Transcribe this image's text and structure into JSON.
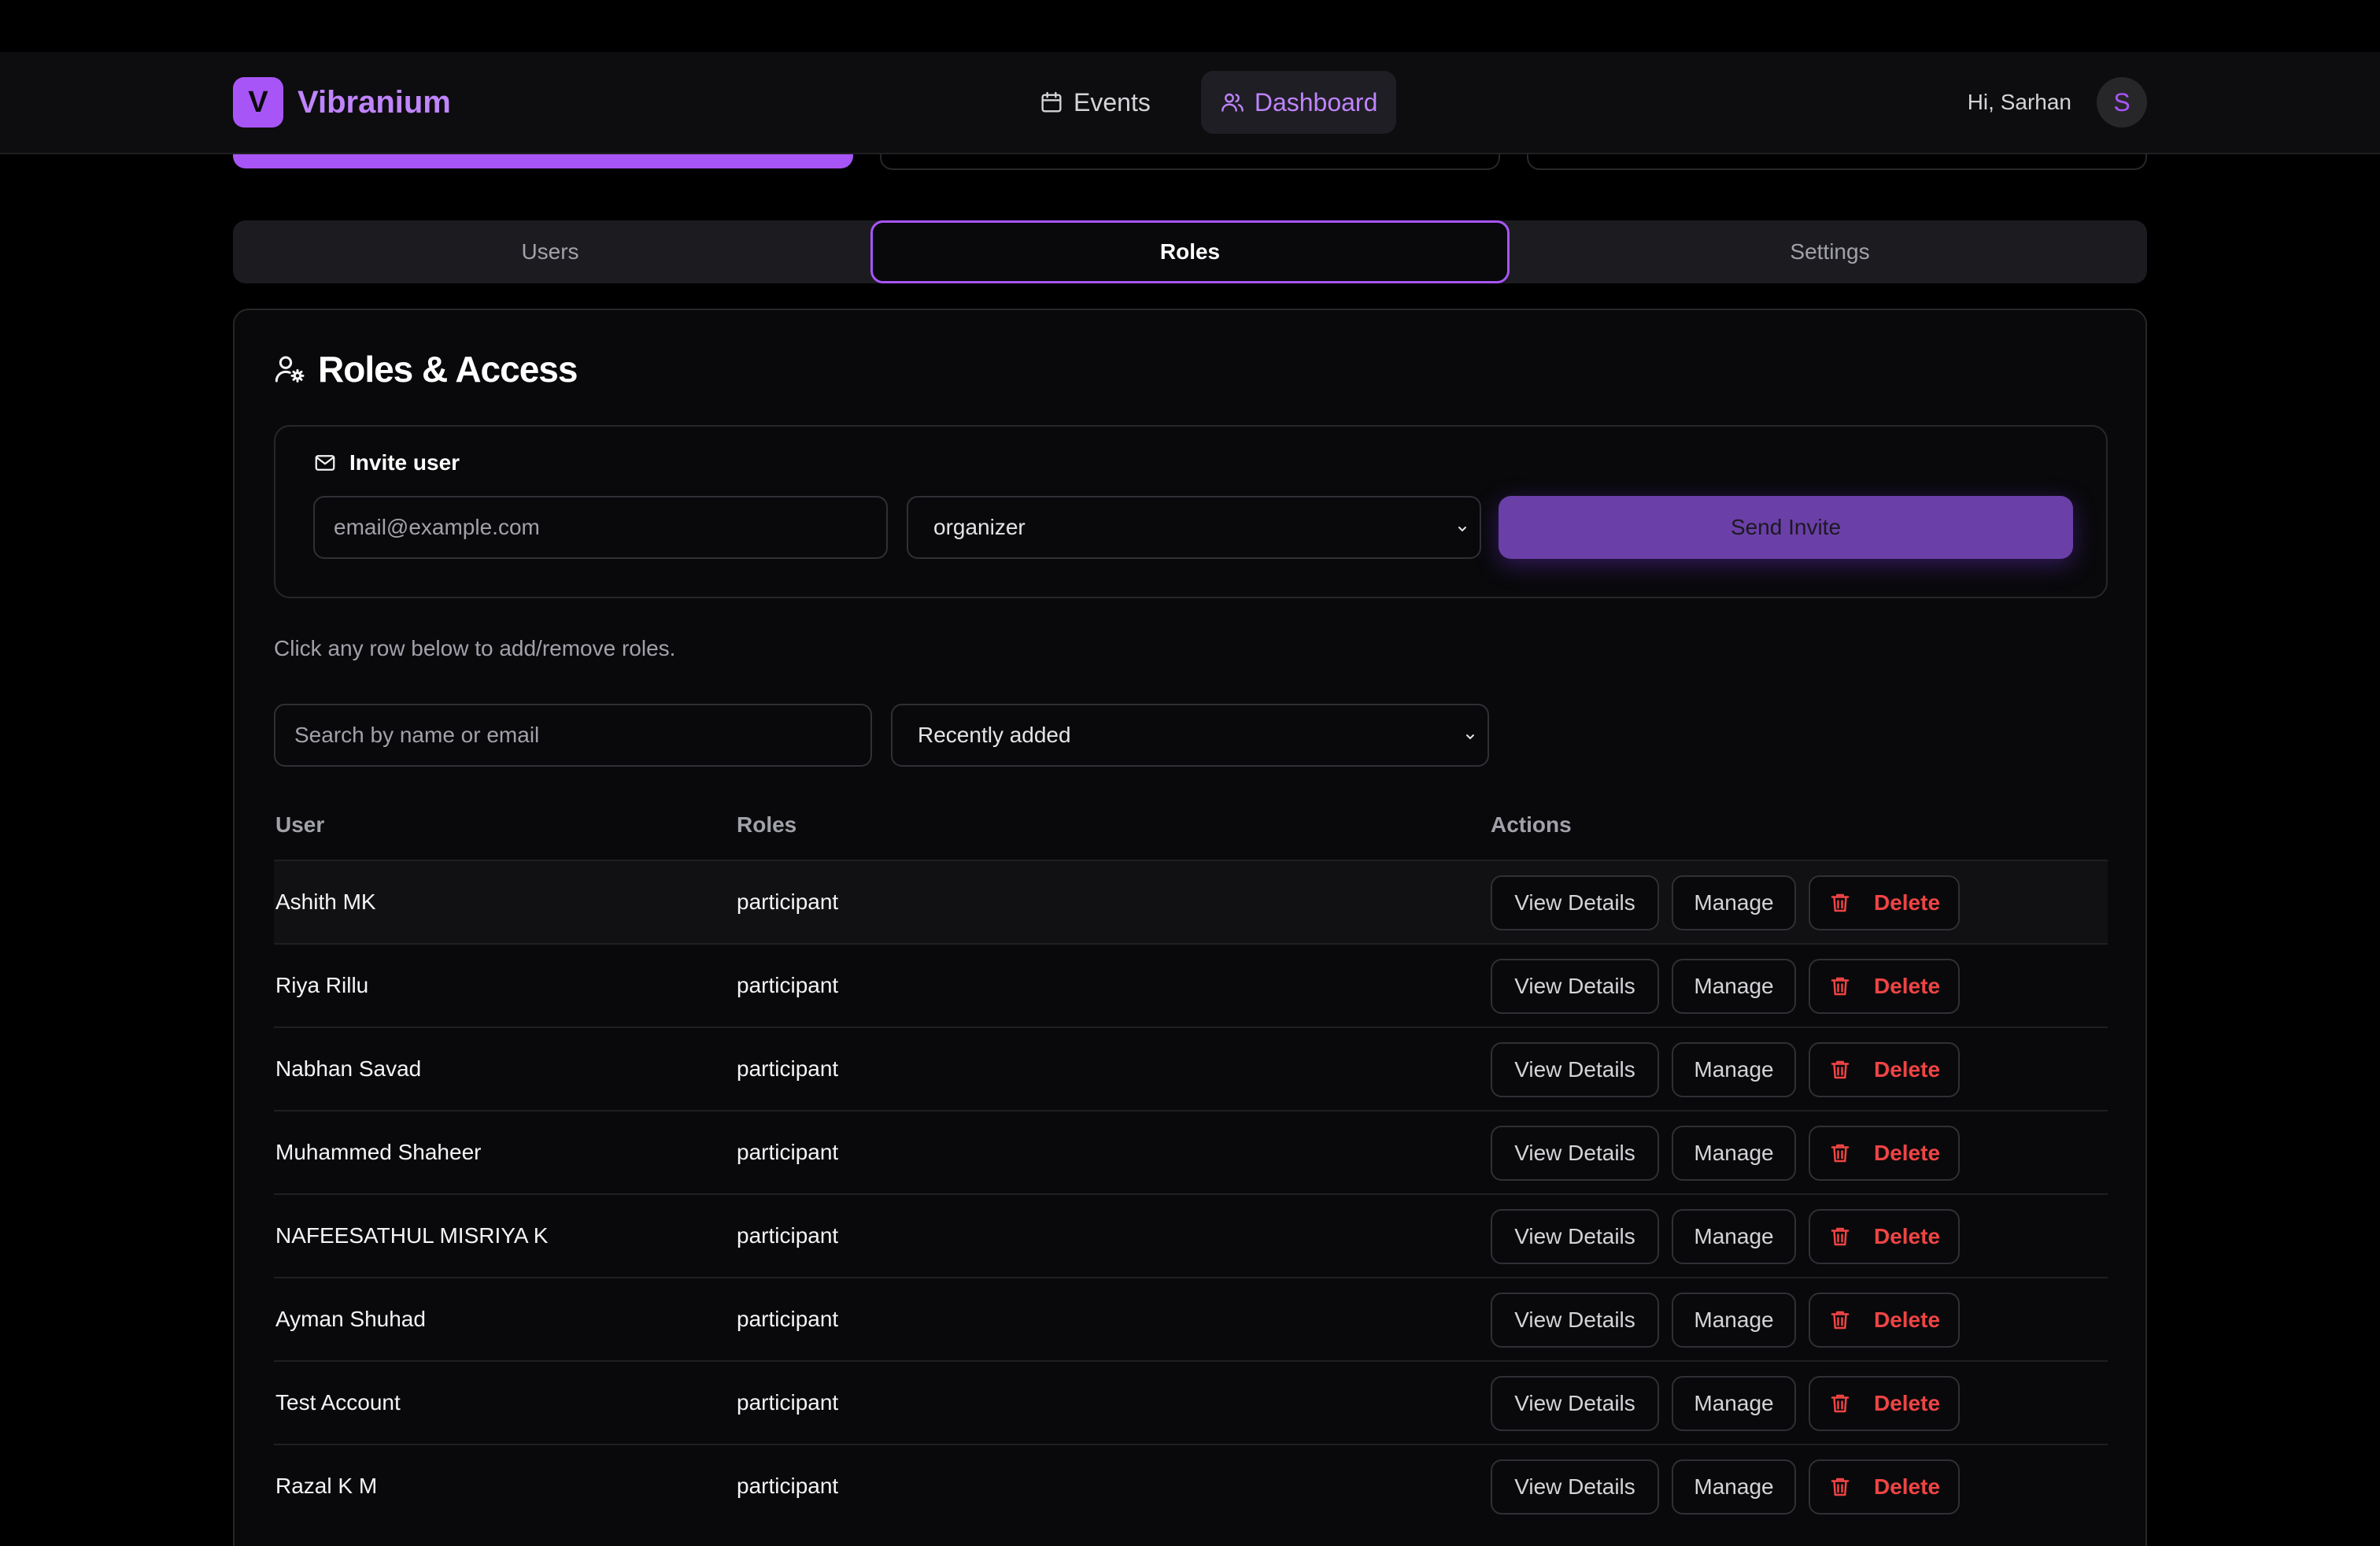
{
  "brand": {
    "logo_letter": "V",
    "name": "Vibranium"
  },
  "nav": {
    "items": [
      {
        "label": "Events",
        "icon": "calendar-icon",
        "active": false
      },
      {
        "label": "Dashboard",
        "icon": "users-icon",
        "active": true
      }
    ]
  },
  "user": {
    "greeting": "Hi, Sarhan",
    "avatar_letter": "S"
  },
  "tabs": [
    {
      "label": "Users",
      "active": false
    },
    {
      "label": "Roles",
      "active": true
    },
    {
      "label": "Settings",
      "active": false
    }
  ],
  "roles_card": {
    "title": "Roles & Access",
    "invite": {
      "label": "Invite user",
      "email_placeholder": "email@example.com",
      "role_value": "organizer",
      "send_label": "Send Invite"
    },
    "hint": "Click any row below to add/remove roles.",
    "search_placeholder": "Search by name or email",
    "sort_value": "Recently added"
  },
  "table": {
    "columns": {
      "user": "User",
      "roles": "Roles",
      "actions": "Actions"
    },
    "actions": {
      "view": "View Details",
      "manage": "Manage",
      "delete": "Delete"
    },
    "rows": [
      {
        "user": "Ashith MK",
        "roles": "participant"
      },
      {
        "user": "Riya Rillu",
        "roles": "participant"
      },
      {
        "user": "Nabhan Savad",
        "roles": "participant"
      },
      {
        "user": "Muhammed Shaheer",
        "roles": "participant"
      },
      {
        "user": "NAFEESATHUL MISRIYA K",
        "roles": "participant"
      },
      {
        "user": "Ayman Shuhad",
        "roles": "participant"
      },
      {
        "user": "Test Account",
        "roles": "participant"
      },
      {
        "user": "Razal K M",
        "roles": "participant"
      }
    ]
  },
  "colors": {
    "accent": "#a855f7",
    "danger": "#ef4444",
    "background": "#09090b"
  }
}
